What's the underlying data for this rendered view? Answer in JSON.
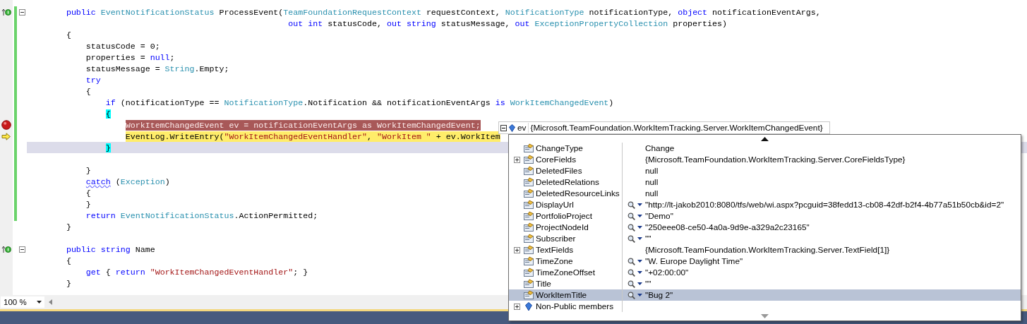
{
  "editor": {
    "lines": [
      {
        "kind": "implements",
        "tokens": [
          {
            "kind": "keyword",
            "text": "        public"
          },
          {
            "kind": "type",
            "text": " EventNotificationStatus"
          },
          {
            "kind": "plain",
            "text": " ProcessEvent("
          },
          {
            "kind": "type",
            "text": "TeamFoundationRequestContext"
          },
          {
            "kind": "plain",
            "text": " requestContext, "
          },
          {
            "kind": "type",
            "text": "NotificationType"
          },
          {
            "kind": "plain",
            "text": " notificationType, "
          },
          {
            "kind": "keyword",
            "text": "object"
          },
          {
            "kind": "plain",
            "text": " notificationEventArgs,"
          }
        ],
        "changed": true,
        "collapsible": true
      },
      {
        "kind": "plain",
        "tokens": [
          {
            "kind": "keyword",
            "text": "                                                     out int"
          },
          {
            "kind": "plain",
            "text": " statusCode, "
          },
          {
            "kind": "keyword",
            "text": "out string"
          },
          {
            "kind": "plain",
            "text": " statusMessage, "
          },
          {
            "kind": "keyword",
            "text": "out"
          },
          {
            "kind": "type",
            "text": " ExceptionPropertyCollection"
          },
          {
            "kind": "plain",
            "text": " properties)"
          }
        ],
        "changed": true,
        "collapsible": false
      },
      {
        "kind": "plain",
        "tokens": [
          {
            "kind": "plain",
            "text": "        {"
          }
        ],
        "changed": true,
        "collapsible": false
      },
      {
        "kind": "plain",
        "tokens": [
          {
            "kind": "plain",
            "text": "            statusCode = 0;"
          }
        ],
        "changed": true,
        "collapsible": false
      },
      {
        "kind": "plain",
        "tokens": [
          {
            "kind": "plain",
            "text": "            properties = "
          },
          {
            "kind": "keyword",
            "text": "null"
          },
          {
            "kind": "plain",
            "text": ";"
          }
        ],
        "changed": true,
        "collapsible": false
      },
      {
        "kind": "plain",
        "tokens": [
          {
            "kind": "plain",
            "text": "            statusMessage = "
          },
          {
            "kind": "type",
            "text": "String"
          },
          {
            "kind": "plain",
            "text": ".Empty;"
          }
        ],
        "changed": true,
        "collapsible": false
      },
      {
        "kind": "plain",
        "tokens": [
          {
            "kind": "keyword",
            "text": "            try"
          }
        ],
        "changed": true,
        "collapsible": false
      },
      {
        "kind": "plain",
        "tokens": [
          {
            "kind": "plain",
            "text": "            {"
          }
        ],
        "changed": true,
        "collapsible": false
      },
      {
        "kind": "plain",
        "tokens": [
          {
            "kind": "keyword",
            "text": "                if"
          },
          {
            "kind": "plain",
            "text": " (notificationType == "
          },
          {
            "kind": "type",
            "text": "NotificationType"
          },
          {
            "kind": "plain",
            "text": ".Notification && notificationEventArgs "
          },
          {
            "kind": "keyword",
            "text": "is"
          },
          {
            "kind": "type",
            "text": " WorkItemChangedEvent"
          },
          {
            "kind": "plain",
            "text": ")"
          }
        ],
        "changed": true,
        "collapsible": false
      },
      {
        "kind": "plain",
        "tokens": [
          {
            "kind": "brace",
            "text": "                {"
          }
        ],
        "changed": true,
        "collapsible": false
      },
      {
        "kind": "breakpoint",
        "tokens": [
          {
            "kind": "plain",
            "text": "                    WorkItemChangedEvent ev = notificationEventArgs as WorkItemChangedEvent;"
          }
        ],
        "changed": true,
        "collapsible": false
      },
      {
        "kind": "current",
        "tokens": [
          {
            "kind": "plain",
            "text": "                    EventLog.WriteEntry("
          },
          {
            "kind": "string",
            "text": "\"WorkItemChangedEventHandler\""
          },
          {
            "kind": "plain",
            "text": ", "
          },
          {
            "kind": "string",
            "text": "\"WorkItem \""
          },
          {
            "kind": "plain",
            "text": " + ev.WorkItem"
          }
        ],
        "changed": true,
        "collapsible": false
      },
      {
        "kind": "caret",
        "tokens": [
          {
            "kind": "brace",
            "text": "                }"
          }
        ],
        "changed": true,
        "collapsible": false
      },
      {
        "kind": "plain",
        "changed": true,
        "collapsible": false
      },
      {
        "kind": "plain",
        "tokens": [
          {
            "kind": "plain",
            "text": "            }"
          }
        ],
        "changed": true,
        "collapsible": false
      },
      {
        "kind": "plain",
        "tokens": [
          {
            "kind": "squiggle",
            "text": "            catch"
          },
          {
            "kind": "plain",
            "text": " ("
          },
          {
            "kind": "type",
            "text": "Exception"
          },
          {
            "kind": "plain",
            "text": ")"
          }
        ],
        "changed": true,
        "collapsible": false
      },
      {
        "kind": "plain",
        "tokens": [
          {
            "kind": "plain",
            "text": "            {"
          }
        ],
        "changed": true,
        "collapsible": false
      },
      {
        "kind": "plain",
        "tokens": [
          {
            "kind": "plain",
            "text": "            }"
          }
        ],
        "changed": true,
        "collapsible": false
      },
      {
        "kind": "plain",
        "tokens": [
          {
            "kind": "keyword",
            "text": "            return"
          },
          {
            "kind": "type",
            "text": " EventNotificationStatus"
          },
          {
            "kind": "plain",
            "text": ".ActionPermitted;"
          }
        ],
        "changed": true,
        "collapsible": false
      },
      {
        "kind": "plain",
        "tokens": [
          {
            "kind": "plain",
            "text": "        }"
          }
        ],
        "changed": false,
        "collapsible": false
      },
      {
        "kind": "plain",
        "changed": false,
        "collapsible": false
      },
      {
        "kind": "implements",
        "tokens": [
          {
            "kind": "keyword",
            "text": "        public string"
          },
          {
            "kind": "plain",
            "text": " Name"
          }
        ],
        "changed": false,
        "collapsible": true
      },
      {
        "kind": "plain",
        "tokens": [
          {
            "kind": "plain",
            "text": "        {"
          }
        ],
        "changed": false,
        "collapsible": false
      },
      {
        "kind": "plain",
        "tokens": [
          {
            "kind": "keyword",
            "text": "            get"
          },
          {
            "kind": "plain",
            "text": " { "
          },
          {
            "kind": "keyword",
            "text": "return"
          },
          {
            "kind": "string",
            "text": " \"WorkItemChangedEventHandler\""
          },
          {
            "kind": "plain",
            "text": "; }"
          }
        ],
        "changed": false,
        "collapsible": false
      },
      {
        "kind": "plain",
        "tokens": [
          {
            "kind": "plain",
            "text": "        }"
          }
        ],
        "changed": false,
        "collapsible": false
      }
    ],
    "zoom": "100 %"
  },
  "datatip": {
    "name": "ev",
    "value": "{Microsoft.TeamFoundation.WorkItemTracking.Server.WorkItemChangedEvent}",
    "expanded": true,
    "rows": [
      {
        "kind": "property",
        "name": "ChangeType",
        "value": "Change",
        "visualizer": false,
        "selected": false
      },
      {
        "kind": "object",
        "name": "CoreFields",
        "value": "{Microsoft.TeamFoundation.WorkItemTracking.Server.CoreFieldsType}",
        "visualizer": false,
        "selected": false
      },
      {
        "kind": "property",
        "name": "DeletedFiles",
        "value": "null",
        "visualizer": false,
        "selected": false
      },
      {
        "kind": "property",
        "name": "DeletedRelations",
        "value": "null",
        "visualizer": false,
        "selected": false
      },
      {
        "kind": "property",
        "name": "DeletedResourceLinks",
        "value": "null",
        "visualizer": false,
        "selected": false
      },
      {
        "kind": "property",
        "name": "DisplayUrl",
        "value": "\"http://lt-jakob2010:8080/tfs/web/wi.aspx?pcguid=38fedd13-cb08-42df-b2f4-4b77a51b50cb&id=2\"",
        "visualizer": true,
        "selected": false
      },
      {
        "kind": "property",
        "name": "PortfolioProject",
        "value": "\"Demo\"",
        "visualizer": true,
        "selected": false
      },
      {
        "kind": "property",
        "name": "ProjectNodeId",
        "value": "\"250eee08-ce50-4a0a-9d9e-a329a2c23165\"",
        "visualizer": true,
        "selected": false
      },
      {
        "kind": "property",
        "name": "Subscriber",
        "value": "\"\"",
        "visualizer": true,
        "selected": false
      },
      {
        "kind": "object",
        "name": "TextFields",
        "value": "{Microsoft.TeamFoundation.WorkItemTracking.Server.TextField[1]}",
        "visualizer": false,
        "selected": false
      },
      {
        "kind": "property",
        "name": "TimeZone",
        "value": "\"W. Europe Daylight Time\"",
        "visualizer": true,
        "selected": false
      },
      {
        "kind": "property",
        "name": "TimeZoneOffset",
        "value": "\"+02:00:00\"",
        "visualizer": true,
        "selected": false
      },
      {
        "kind": "property",
        "name": "Title",
        "value": "\"\"",
        "visualizer": true,
        "selected": false
      },
      {
        "kind": "property",
        "name": "WorkItemTitle",
        "value": "\"Bug 2\"",
        "visualizer": true,
        "selected": true
      },
      {
        "kind": "members",
        "name": "Non-Public members",
        "visualizer": false,
        "selected": false
      }
    ]
  }
}
